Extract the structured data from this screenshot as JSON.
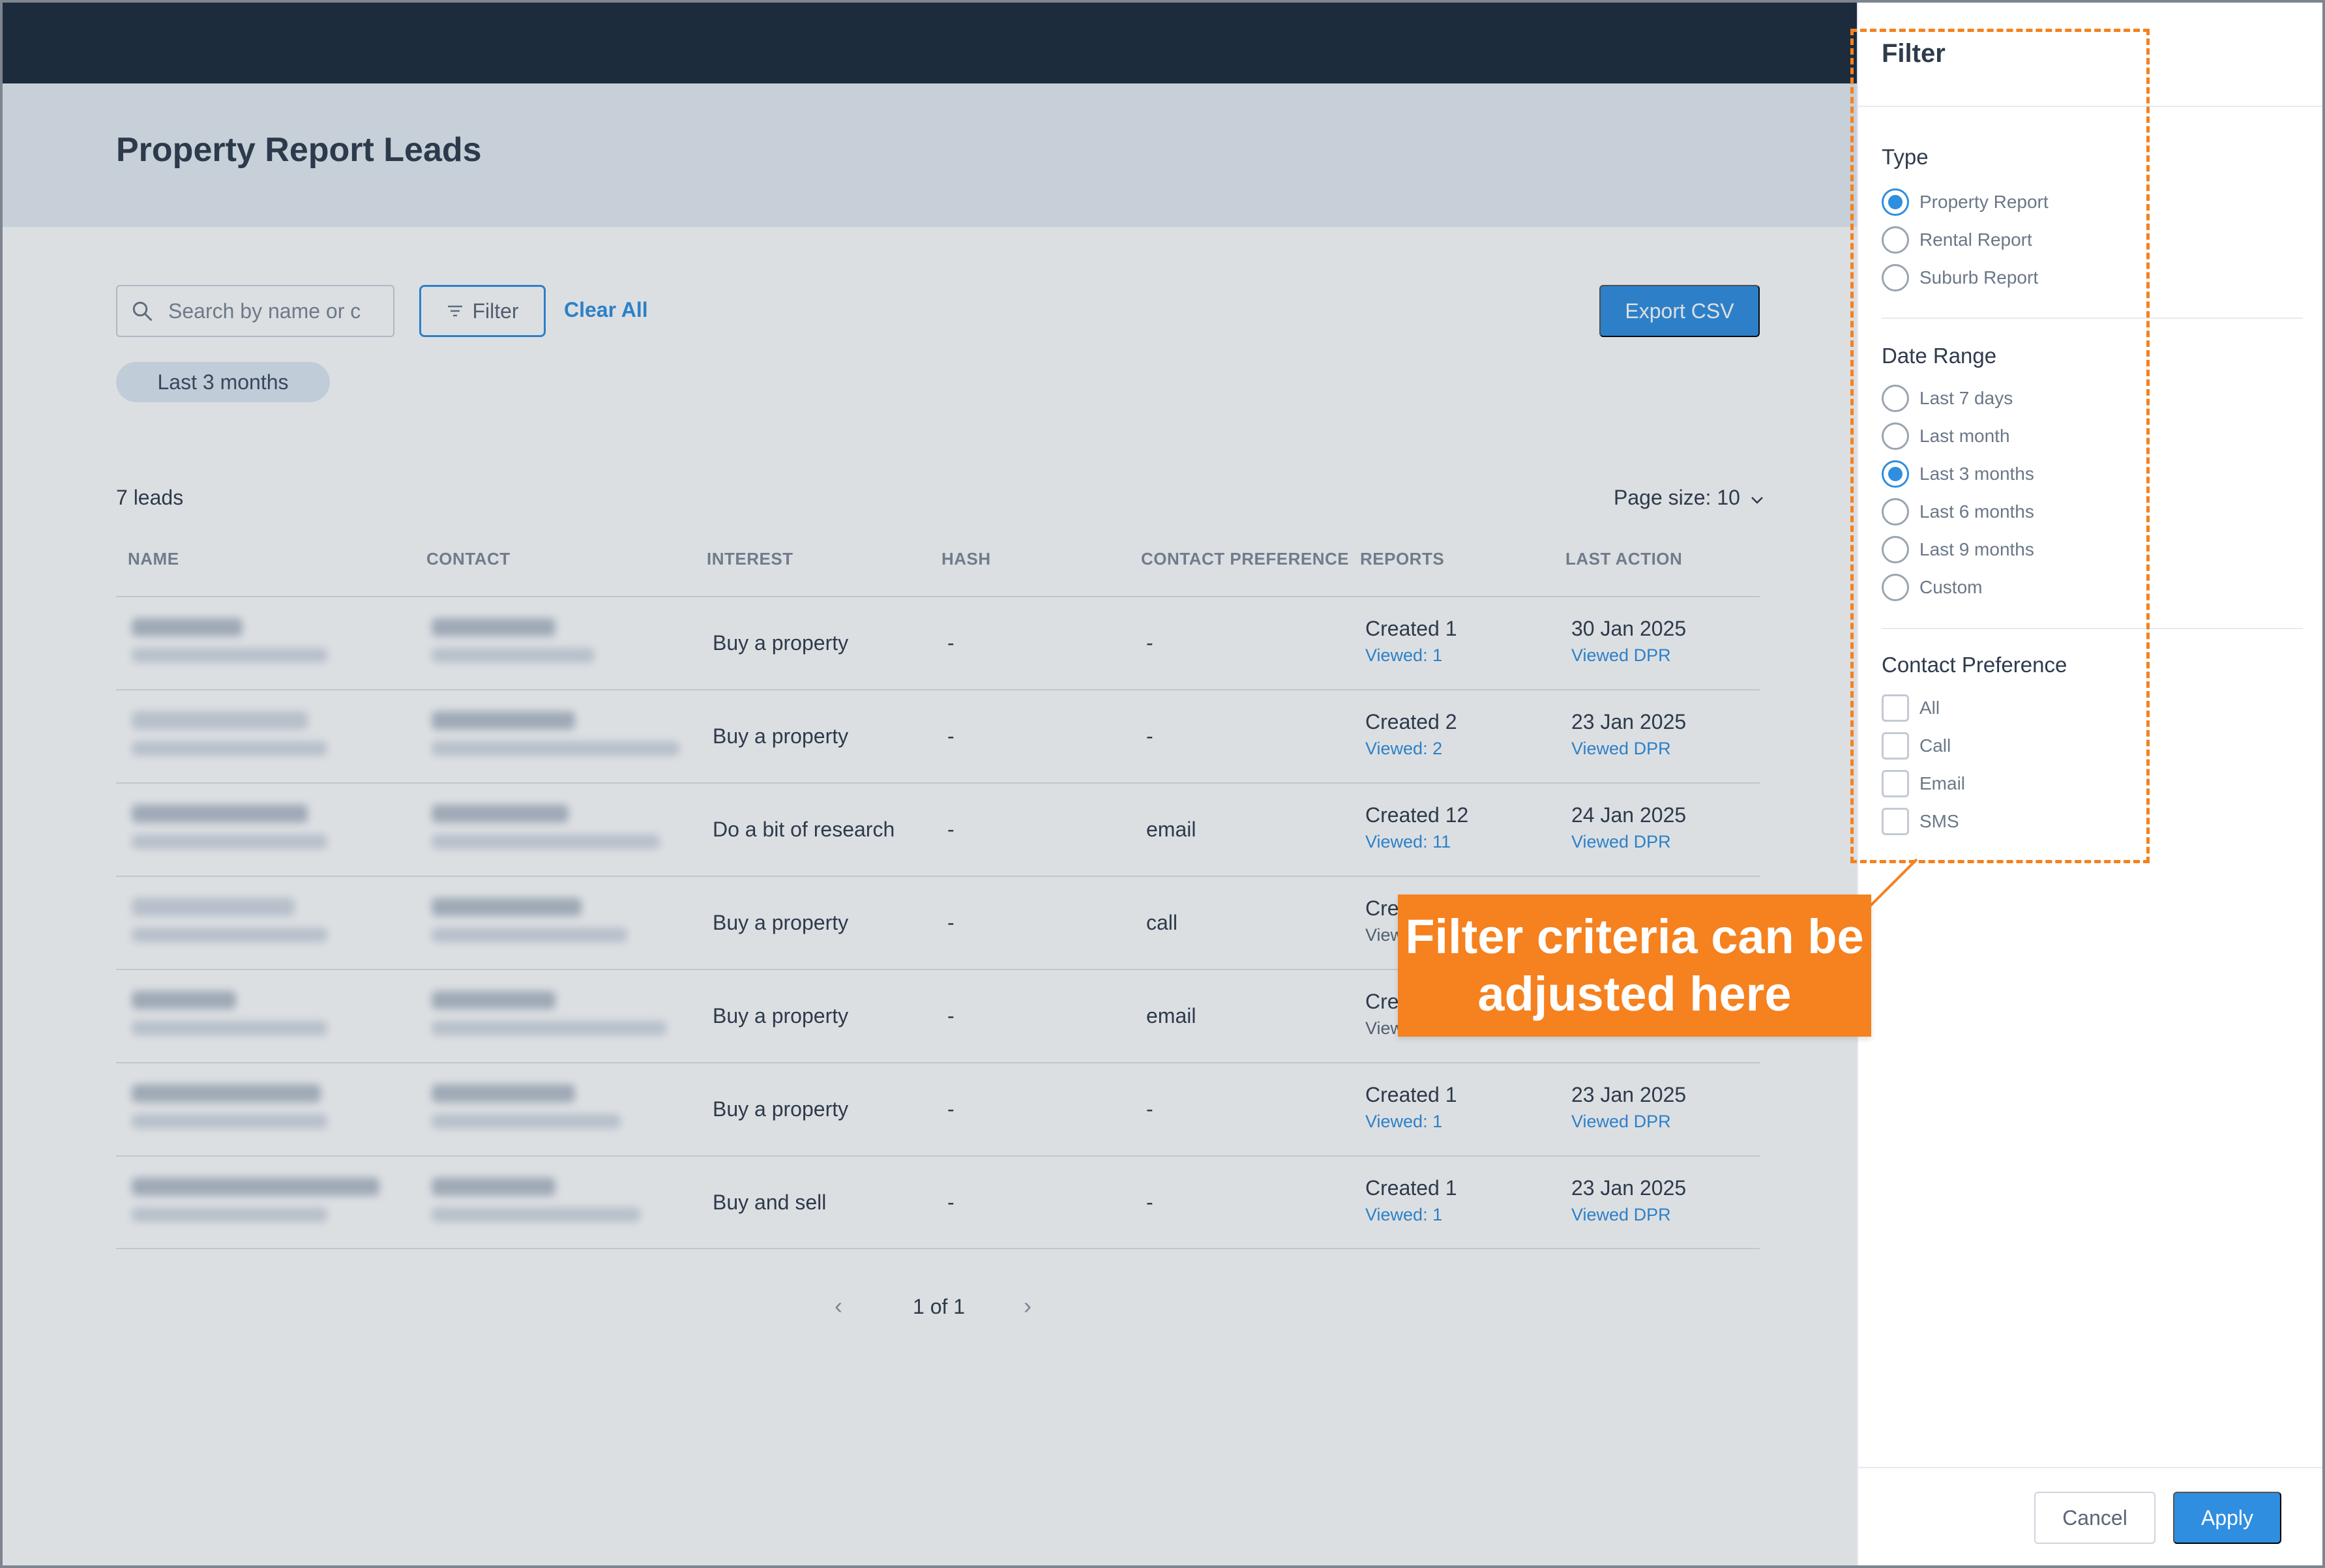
{
  "page": {
    "title": "Property Report Leads"
  },
  "toolbar": {
    "search_placeholder": "Search by name or c",
    "filter_label": "Filter",
    "clear_all_label": "Clear All",
    "export_label": "Export CSV",
    "active_chip": "Last 3 months"
  },
  "table": {
    "count_label": "7 leads",
    "page_size_label": "Page size: 10",
    "columns": [
      "NAME",
      "CONTACT",
      "INTEREST",
      "HASH",
      "CONTACT PREFERENCE",
      "REPORTS",
      "LAST ACTION"
    ],
    "rows": [
      {
        "interest": "Buy a property",
        "hash": "-",
        "pref": "-",
        "reports": "Created 1",
        "viewed": "Viewed: 1",
        "last": "30 Jan 2025",
        "last_sub": "Viewed DPR"
      },
      {
        "interest": "Buy a property",
        "hash": "-",
        "pref": "-",
        "reports": "Created 2",
        "viewed": "Viewed: 2",
        "last": "23 Jan 2025",
        "last_sub": "Viewed DPR"
      },
      {
        "interest": "Do a bit of research",
        "hash": "-",
        "pref": "email",
        "reports": "Created 12",
        "viewed": "Viewed: 11",
        "last": "24 Jan 2025",
        "last_sub": "Viewed DPR"
      },
      {
        "interest": "Buy a property",
        "hash": "-",
        "pref": "call",
        "reports": "Cre",
        "viewed": "View",
        "last": "",
        "last_sub": ""
      },
      {
        "interest": "Buy a property",
        "hash": "-",
        "pref": "email",
        "reports": "Cre",
        "viewed": "View",
        "last": "",
        "last_sub": ""
      },
      {
        "interest": "Buy a property",
        "hash": "-",
        "pref": "-",
        "reports": "Created 1",
        "viewed": "Viewed: 1",
        "last": "23 Jan 2025",
        "last_sub": "Viewed DPR"
      },
      {
        "interest": "Buy and sell",
        "hash": "-",
        "pref": "-",
        "reports": "Created 1",
        "viewed": "Viewed: 1",
        "last": "23 Jan 2025",
        "last_sub": "Viewed DPR"
      }
    ]
  },
  "pagination": {
    "label": "1 of 1"
  },
  "filter_panel": {
    "title": "Filter",
    "type": {
      "title": "Type",
      "options": [
        "Property Report",
        "Rental Report",
        "Suburb Report"
      ],
      "selected": "Property Report"
    },
    "date_range": {
      "title": "Date Range",
      "options": [
        "Last 7 days",
        "Last month",
        "Last 3 months",
        "Last 6 months",
        "Last 9 months",
        "Custom"
      ],
      "selected": "Last 3 months"
    },
    "contact_preference": {
      "title": "Contact Preference",
      "options": [
        "All",
        "Call",
        "Email",
        "SMS"
      ]
    },
    "cancel_label": "Cancel",
    "apply_label": "Apply"
  },
  "callout": {
    "text": "Filter criteria can be adjusted here"
  },
  "colors": {
    "accent": "#2f8ee0",
    "callout": "#f5811f",
    "topbar": "#1c2a3a"
  }
}
